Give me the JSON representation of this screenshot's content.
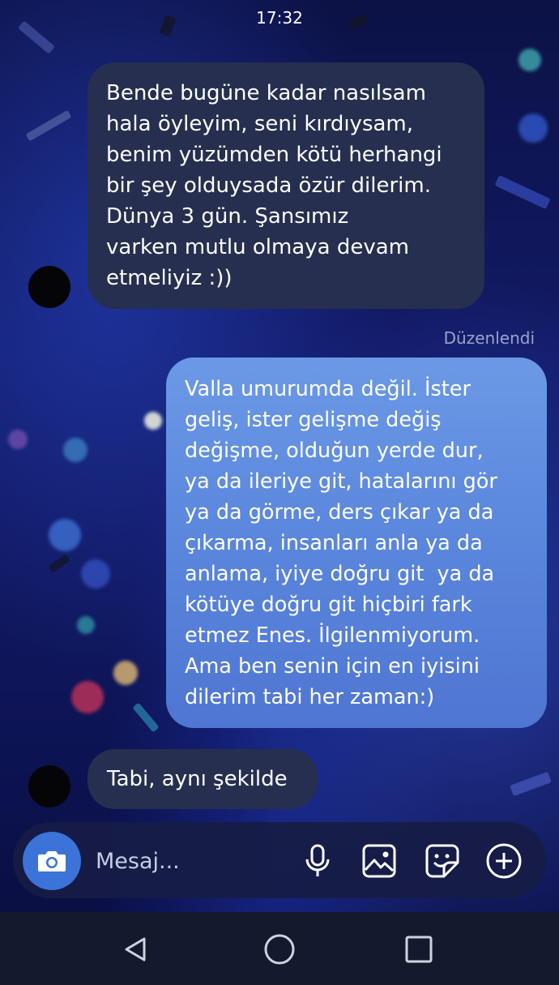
{
  "status": {
    "time": "17:32"
  },
  "messages": [
    {
      "direction": "received",
      "lines": [
        "Bende bugüne kadar nasılsam",
        "hala öyleyim, seni kırdıysam,",
        "benim yüzümden kötü herhangi",
        "bir şey olduysada özür dilerim.",
        "Dünya 3 gün. Şansımız",
        "varken mutlu olmaya devam",
        "etmeliyiz :))"
      ]
    },
    {
      "direction": "sent",
      "edited_label": "Düzenlendi",
      "lines": [
        "Valla umurumda değil. İster",
        "geliş, ister gelişme değiş",
        "değişme, olduğun yerde dur,",
        "ya da ileriye git, hatalarını gör",
        "ya da görme, ders çıkar ya da",
        "çıkarma, insanları anla ya da",
        "anlama, iyiye doğru git  ya da",
        "kötüye doğru git hiçbiri fark",
        "etmez Enes. İlgilenmiyorum.",
        "Ama ben senin için en iyisini",
        "dilerim tabi her zaman:)"
      ]
    },
    {
      "direction": "received",
      "lines": [
        "Tabi, aynı şekilde"
      ]
    }
  ],
  "composer": {
    "placeholder": "Mesaj...",
    "value": "",
    "icons": [
      "camera-icon",
      "microphone-icon",
      "gallery-icon",
      "sticker-icon",
      "plus-icon"
    ]
  },
  "navigation": {
    "icons": [
      "back-icon",
      "home-icon",
      "recents-icon"
    ]
  },
  "colors": {
    "received_bubble": "#262f4f",
    "sent_bubble": "#5a86dc",
    "camera_button": "#3b73d8",
    "nav_bar": "#141a2e"
  }
}
